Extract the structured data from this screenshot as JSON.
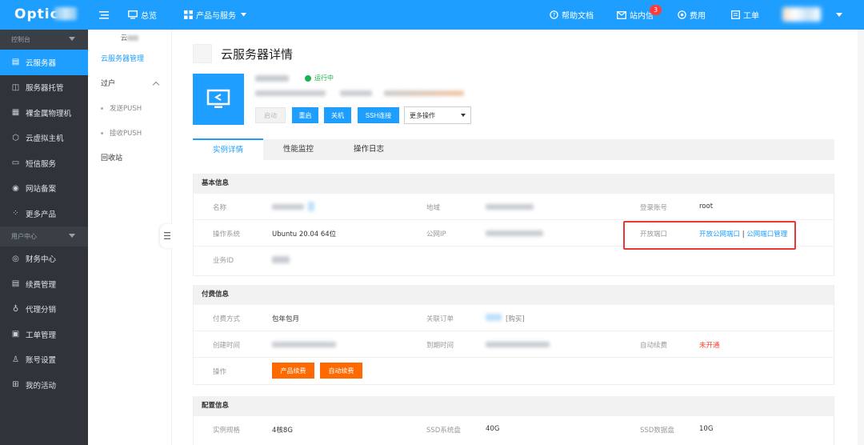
{
  "header": {
    "logo_text": "Optic",
    "menu_toggle_label": "☰",
    "nav_overview": "总览",
    "nav_products": "产品与服务",
    "help_docs": "帮助文档",
    "messages": "站内信",
    "message_count": "3",
    "billing": "费用",
    "tickets": "工单"
  },
  "sidebar": {
    "group_console": "控制台",
    "items_console": [
      {
        "label": "云服务器",
        "icon": "server-icon"
      },
      {
        "label": "服务器托管",
        "icon": "hosting-icon"
      },
      {
        "label": "裸金属物理机",
        "icon": "bare-metal-icon"
      },
      {
        "label": "云虚拟主机",
        "icon": "virtual-host-icon"
      },
      {
        "label": "短信服务",
        "icon": "sms-icon"
      },
      {
        "label": "网站备案",
        "icon": "record-icon"
      },
      {
        "label": "更多产品",
        "icon": "more-products-icon"
      }
    ],
    "group_user": "用户中心",
    "items_user": [
      {
        "label": "财务中心",
        "icon": "finance-icon"
      },
      {
        "label": "续费管理",
        "icon": "renew-icon"
      },
      {
        "label": "代理分销",
        "icon": "agent-icon"
      },
      {
        "label": "工单管理",
        "icon": "ticket-icon"
      },
      {
        "label": "账号设置",
        "icon": "account-icon"
      },
      {
        "label": "我的活动",
        "icon": "gift-icon"
      }
    ]
  },
  "subnav": {
    "top_label": "云",
    "items": [
      {
        "label": "云服务器管理"
      },
      {
        "label": "过户"
      },
      {
        "label": "发送PUSH"
      },
      {
        "label": "接收PUSH"
      },
      {
        "label": "回收站"
      }
    ]
  },
  "main": {
    "title": "云服务器详情",
    "status": "运行中",
    "buttons": {
      "start": "启动",
      "restart": "重启",
      "shutdown": "关机",
      "ssh": "SSH连接",
      "more": "更多操作"
    },
    "tabs": [
      "实例详情",
      "性能监控",
      "操作日志"
    ],
    "basic": {
      "heading": "基本信息",
      "name_label": "名称",
      "region_label": "地域",
      "login_label": "登录账号",
      "login_value": "root",
      "os_label": "操作系统",
      "os_value": "Ubuntu 20.04 64位",
      "ip_label": "公网IP",
      "ports_label": "开放端口",
      "ports_link1": "开放公网端口",
      "ports_sep": "|",
      "ports_link2": "公网端口管理",
      "id_label": "业务ID"
    },
    "billing": {
      "heading": "付费信息",
      "mode_label": "付费方式",
      "mode_value": "包年包月",
      "order_label": "关联订单",
      "order_link": "[购买]",
      "created_label": "创建时间",
      "expire_label": "到期时间",
      "auto_renew_label": "自动续费",
      "auto_renew_value": "未开通",
      "op_label": "操作",
      "renew_button": "产品续费",
      "auto_renew_button": "自动续费"
    },
    "config": {
      "heading": "配置信息",
      "spec_label": "实例规格",
      "spec_value": "4核8G",
      "sys_disk_label": "SSD系统盘",
      "sys_disk_value": "40G",
      "data_disk_label": "SSD数据盘",
      "data_disk_value": "10G"
    }
  },
  "colors": {
    "primary": "#1e9fff",
    "sidebar_bg": "#30343a",
    "orange": "#ff6a00",
    "status_green": "#19b24b",
    "alert_red": "#ff3b30",
    "highlight_border": "#e53935"
  }
}
